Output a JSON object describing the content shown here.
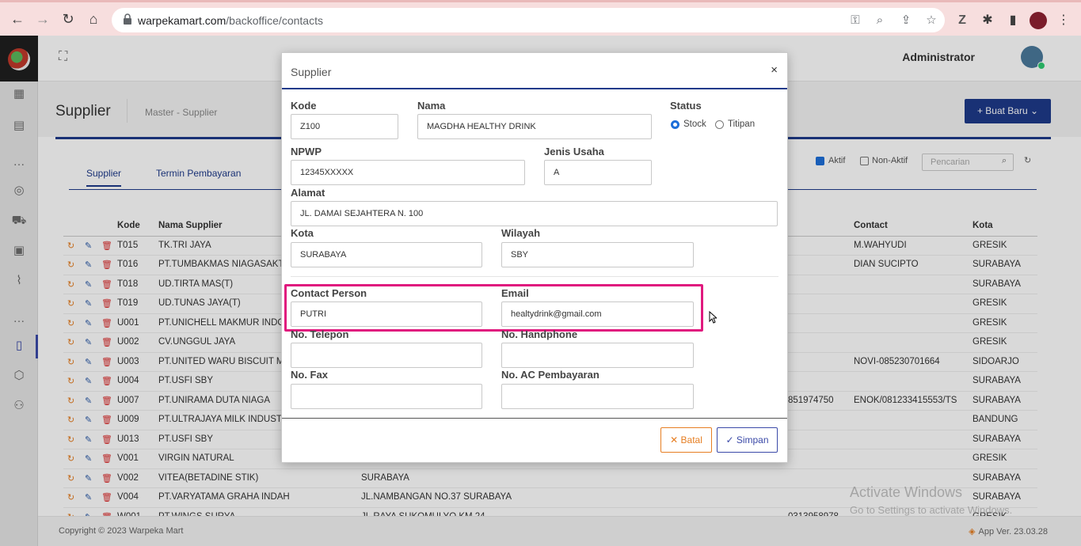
{
  "browser": {
    "url_host": "warpekamart.com",
    "url_path": "/backoffice/contacts"
  },
  "topbar": {
    "user_name": "Administrator"
  },
  "page": {
    "title": "Supplier",
    "breadcrumb": "Master   -  Supplier",
    "new_button": "+ Buat Baru ⌄"
  },
  "tabs": [
    {
      "label": "Supplier"
    },
    {
      "label": "Termin Pembayaran"
    }
  ],
  "filters": {
    "aktif": "Aktif",
    "non_aktif": "Non-Aktif",
    "search_placeholder": "Pencarian"
  },
  "grid": {
    "headers": {
      "kode": "Kode",
      "nama": "Nama Supplier",
      "contact": "Contact",
      "kota": "Kota"
    },
    "rows": [
      {
        "kode": "T015",
        "nama": "TK.TRI JAYA",
        "alamat": "",
        "telp": "",
        "contact": "M.WAHYUDI",
        "kota": "GRESIK"
      },
      {
        "kode": "T016",
        "nama": "PT.TUMBAKMAS NIAGASAKTI",
        "alamat": "",
        "telp": "",
        "contact": "DIAN SUCIPTO",
        "kota": "SURABAYA"
      },
      {
        "kode": "T018",
        "nama": "UD.TIRTA MAS(T)",
        "alamat": "",
        "telp": "",
        "contact": "",
        "kota": "SURABAYA"
      },
      {
        "kode": "T019",
        "nama": "UD.TUNAS JAYA(T)",
        "alamat": "",
        "telp": "",
        "contact": "",
        "kota": "GRESIK"
      },
      {
        "kode": "U001",
        "nama": "PT.UNICHELL MAKMUR INDO",
        "alamat": "",
        "telp": "",
        "contact": "",
        "kota": "GRESIK"
      },
      {
        "kode": "U002",
        "nama": "CV.UNGGUL JAYA",
        "alamat": "",
        "telp": "",
        "contact": "",
        "kota": "GRESIK"
      },
      {
        "kode": "U003",
        "nama": "PT.UNITED WARU BISCUIT MA",
        "alamat": "",
        "telp": "",
        "contact": "NOVI-085230701664",
        "kota": "SIDOARJO"
      },
      {
        "kode": "U004",
        "nama": "PT.USFI SBY",
        "alamat": "",
        "telp": "",
        "contact": "",
        "kota": "SURABAYA"
      },
      {
        "kode": "U007",
        "nama": "PT.UNIRAMA DUTA NIAGA",
        "alamat": "",
        "telp": "851974750",
        "contact": "ENOK/081233415553/TS",
        "kota": "SURABAYA"
      },
      {
        "kode": "U009",
        "nama": "PT.ULTRAJAYA MILK INDUSTR",
        "alamat": "",
        "telp": "",
        "contact": "",
        "kota": "BANDUNG"
      },
      {
        "kode": "U013",
        "nama": "PT.USFI SBY",
        "alamat": "",
        "telp": "",
        "contact": "",
        "kota": "SURABAYA"
      },
      {
        "kode": "V001",
        "nama": "VIRGIN NATURAL",
        "alamat": "",
        "telp": "",
        "contact": "",
        "kota": "GRESIK"
      },
      {
        "kode": "V002",
        "nama": "VITEA(BETADINE STIK)",
        "alamat": "SURABAYA",
        "telp": "",
        "contact": "",
        "kota": "SURABAYA"
      },
      {
        "kode": "V004",
        "nama": "PT.VARYATAMA GRAHA INDAH",
        "alamat": "JL.NAMBANGAN NO.37 SURABAYA",
        "telp": "",
        "contact": "",
        "kota": "SURABAYA"
      },
      {
        "kode": "W001",
        "nama": "PT.WINGS SURYA",
        "alamat": "JL.RAYA SUKOMULYO KM 24",
        "telp": "0313958978",
        "contact": "",
        "kota": "GRESIK"
      }
    ]
  },
  "footer": {
    "copyright": "Copyright © 2023 Warpeka Mart",
    "version": "App Ver. 23.03.28"
  },
  "watermark": {
    "line1": "Activate Windows",
    "line2": "Go to Settings to activate Windows."
  },
  "modal": {
    "title": "Supplier",
    "close": "×",
    "fields": {
      "kode": {
        "label": "Kode",
        "value": "Z100"
      },
      "nama": {
        "label": "Nama",
        "value": "MAGDHA HEALTHY DRINK"
      },
      "status": {
        "label": "Status",
        "opt_stock": "Stock",
        "opt_titipan": "Titipan"
      },
      "npwp": {
        "label": "NPWP",
        "value": "12345XXXXX"
      },
      "jenis_usaha": {
        "label": "Jenis Usaha",
        "value": "A"
      },
      "alamat": {
        "label": "Alamat",
        "value": "JL. DAMAI SEJAHTERA N. 100"
      },
      "kota": {
        "label": "Kota",
        "value": "SURABAYA"
      },
      "wilayah": {
        "label": "Wilayah",
        "value": "SBY"
      },
      "contact_person": {
        "label": "Contact Person",
        "value": "PUTRI"
      },
      "email": {
        "label": "Email",
        "value": "healtydrink@gmail.com"
      },
      "no_telepon": {
        "label": "No. Telepon",
        "value": ""
      },
      "no_handphone": {
        "label": "No. Handphone",
        "value": ""
      },
      "no_fax": {
        "label": "No. Fax",
        "value": ""
      },
      "no_ac": {
        "label": "No. AC Pembayaran",
        "value": ""
      }
    },
    "batal": "✕ Batal",
    "simpan": "✓ Simpan"
  }
}
